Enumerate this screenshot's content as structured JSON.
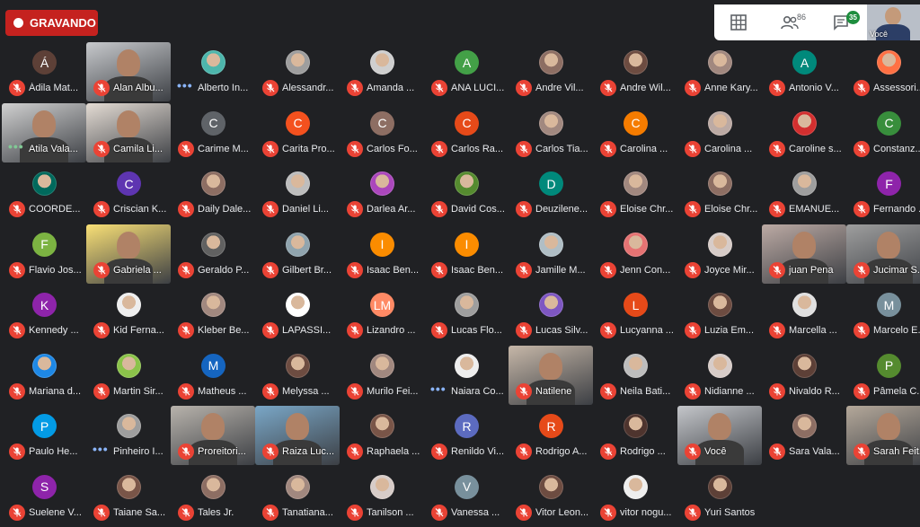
{
  "recording": {
    "label": "GRAVANDO"
  },
  "toolbar": {
    "participants_count": "86",
    "chat_count": "35",
    "self_label": "Você"
  },
  "participants": [
    {
      "name": "Ádila Mat...",
      "avatar": "Á",
      "color": "#5d4037",
      "state": "muted"
    },
    {
      "name": "Alan Albu...",
      "avatar": "",
      "color": "#c7c9cc",
      "state": "muted",
      "video": true
    },
    {
      "name": "Alberto In...",
      "avatar": "",
      "color": "#4db6ac",
      "state": "speaking"
    },
    {
      "name": "Alessandr...",
      "avatar": "",
      "color": "#9e9e9e",
      "state": "muted"
    },
    {
      "name": "Amanda ...",
      "avatar": "",
      "color": "#cfcfcf",
      "state": "muted"
    },
    {
      "name": "ANA LUCI...",
      "avatar": "A",
      "color": "#43a047",
      "state": "muted"
    },
    {
      "name": "Andre Vil...",
      "avatar": "",
      "color": "#8d6e63",
      "state": "muted"
    },
    {
      "name": "Andre Wil...",
      "avatar": "",
      "color": "#6d4c41",
      "state": "muted"
    },
    {
      "name": "Anne Kary...",
      "avatar": "",
      "color": "#a1887f",
      "state": "muted"
    },
    {
      "name": "Antonio V...",
      "avatar": "A",
      "color": "#00897b",
      "state": "muted"
    },
    {
      "name": "Assessori...",
      "avatar": "",
      "color": "#ff7043",
      "state": "muted"
    },
    {
      "name": "Atila Vala...",
      "avatar": "",
      "color": "#d0d0d0",
      "state": "speaking-green",
      "video": true
    },
    {
      "name": "Camila Li...",
      "avatar": "",
      "color": "#e4dcd4",
      "state": "muted",
      "video": true
    },
    {
      "name": "Carime M...",
      "avatar": "C",
      "color": "#5f6368",
      "state": "muted"
    },
    {
      "name": "Carita Pro...",
      "avatar": "C",
      "color": "#f4511e",
      "state": "muted"
    },
    {
      "name": "Carlos Fo...",
      "avatar": "C",
      "color": "#8d6e63",
      "state": "muted"
    },
    {
      "name": "Carlos Ra...",
      "avatar": "C",
      "color": "#e64a19",
      "state": "muted"
    },
    {
      "name": "Carlos Tia...",
      "avatar": "",
      "color": "#a1887f",
      "state": "muted"
    },
    {
      "name": "Carolina ...",
      "avatar": "C",
      "color": "#f57c00",
      "state": "muted"
    },
    {
      "name": "Carolina ...",
      "avatar": "",
      "color": "#bcaaa4",
      "state": "muted"
    },
    {
      "name": "Caroline s...",
      "avatar": "",
      "color": "#d32f2f",
      "state": "muted"
    },
    {
      "name": "Constanz...",
      "avatar": "C",
      "color": "#388e3c",
      "state": "muted"
    },
    {
      "name": "COORDE...",
      "avatar": "",
      "color": "#00695c",
      "state": "muted"
    },
    {
      "name": "Criscian K...",
      "avatar": "C",
      "color": "#5e35b1",
      "state": "muted"
    },
    {
      "name": "Daily Dale...",
      "avatar": "",
      "color": "#8d6e63",
      "state": "muted"
    },
    {
      "name": "Daniel Li...",
      "avatar": "",
      "color": "#bdbdbd",
      "state": "muted"
    },
    {
      "name": "Darlea Ar...",
      "avatar": "",
      "color": "#ab47bc",
      "state": "muted"
    },
    {
      "name": "David Cos...",
      "avatar": "",
      "color": "#558b2f",
      "state": "muted"
    },
    {
      "name": "Deuzilene...",
      "avatar": "D",
      "color": "#00897b",
      "state": "muted"
    },
    {
      "name": "Eloise Chr...",
      "avatar": "",
      "color": "#a1887f",
      "state": "muted"
    },
    {
      "name": "Eloise Chr...",
      "avatar": "",
      "color": "#8d6e63",
      "state": "muted"
    },
    {
      "name": "EMANUE...",
      "avatar": "",
      "color": "#9e9e9e",
      "state": "muted"
    },
    {
      "name": "Fernando ...",
      "avatar": "F",
      "color": "#8e24aa",
      "state": "muted"
    },
    {
      "name": "Flavio Jos...",
      "avatar": "F",
      "color": "#7cb342",
      "state": "muted"
    },
    {
      "name": "Gabriela ...",
      "avatar": "",
      "color": "#f9e076",
      "state": "muted",
      "video": true
    },
    {
      "name": "Geraldo P...",
      "avatar": "",
      "color": "#616161",
      "state": "muted"
    },
    {
      "name": "Gilbert Br...",
      "avatar": "",
      "color": "#90a4ae",
      "state": "muted"
    },
    {
      "name": "Isaac Ben...",
      "avatar": "I",
      "color": "#fb8c00",
      "state": "muted"
    },
    {
      "name": "Isaac Ben...",
      "avatar": "I",
      "color": "#fb8c00",
      "state": "muted"
    },
    {
      "name": "Jamille M...",
      "avatar": "",
      "color": "#b0bec5",
      "state": "muted"
    },
    {
      "name": "Jenn Con...",
      "avatar": "",
      "color": "#e57373",
      "state": "muted"
    },
    {
      "name": "Joyce Mir...",
      "avatar": "",
      "color": "#d7ccc8",
      "state": "muted"
    },
    {
      "name": "juan Pena",
      "avatar": "",
      "color": "#bcaaa4",
      "state": "muted",
      "video": true
    },
    {
      "name": "Jucimar S...",
      "avatar": "",
      "color": "#9e9e9e",
      "state": "muted",
      "video": true
    },
    {
      "name": "Kennedy ...",
      "avatar": "K",
      "color": "#8e24aa",
      "state": "muted"
    },
    {
      "name": "Kid Ferna...",
      "avatar": "",
      "color": "#eeeeee",
      "state": "muted"
    },
    {
      "name": "Kleber Be...",
      "avatar": "",
      "color": "#a1887f",
      "state": "muted"
    },
    {
      "name": "LAPASSI...",
      "avatar": "",
      "color": "#ffffff",
      "state": "muted"
    },
    {
      "name": "Lizandro ...",
      "avatar": "LM",
      "color": "#ff8a65",
      "state": "muted"
    },
    {
      "name": "Lucas Flo...",
      "avatar": "",
      "color": "#9e9e9e",
      "state": "muted"
    },
    {
      "name": "Lucas Silv...",
      "avatar": "",
      "color": "#7e57c2",
      "state": "muted"
    },
    {
      "name": "Lucyanna ...",
      "avatar": "L",
      "color": "#e64a19",
      "state": "muted"
    },
    {
      "name": "Luzia Em...",
      "avatar": "",
      "color": "#6d4c41",
      "state": "muted"
    },
    {
      "name": "Marcella ...",
      "avatar": "",
      "color": "#e0e0e0",
      "state": "muted"
    },
    {
      "name": "Marcelo E...",
      "avatar": "M",
      "color": "#78909c",
      "state": "muted"
    },
    {
      "name": "Mariana d...",
      "avatar": "",
      "color": "#1e88e5",
      "state": "muted"
    },
    {
      "name": "Martin Sir...",
      "avatar": "",
      "color": "#8bc34a",
      "state": "muted"
    },
    {
      "name": "Matheus ...",
      "avatar": "M",
      "color": "#1565c0",
      "state": "muted"
    },
    {
      "name": "Melyssa ...",
      "avatar": "",
      "color": "#6d4c41",
      "state": "muted"
    },
    {
      "name": "Murilo Fei...",
      "avatar": "",
      "color": "#a1887f",
      "state": "muted"
    },
    {
      "name": "Naiara Co...",
      "avatar": "",
      "color": "#eeeeee",
      "state": "speaking"
    },
    {
      "name": "Natilene",
      "avatar": "",
      "color": "#c6b7a8",
      "state": "muted",
      "video": true
    },
    {
      "name": "Neila Bati...",
      "avatar": "",
      "color": "#bdbdbd",
      "state": "muted"
    },
    {
      "name": "Nidianne ...",
      "avatar": "",
      "color": "#d7ccc8",
      "state": "muted"
    },
    {
      "name": "Nivaldo R...",
      "avatar": "",
      "color": "#5d4037",
      "state": "muted"
    },
    {
      "name": "Pâmela C...",
      "avatar": "P",
      "color": "#558b2f",
      "state": "muted"
    },
    {
      "name": "Paulo He...",
      "avatar": "P",
      "color": "#039be5",
      "state": "muted"
    },
    {
      "name": "Pinheiro I...",
      "avatar": "",
      "color": "#9e9e9e",
      "state": "speaking"
    },
    {
      "name": "Proreitori...",
      "avatar": "",
      "color": "#b8b3ac",
      "state": "muted",
      "video": true
    },
    {
      "name": "Raiza Luc...",
      "avatar": "",
      "color": "#7aa7c7",
      "state": "muted",
      "video": true
    },
    {
      "name": "Raphaela ...",
      "avatar": "",
      "color": "#795548",
      "state": "muted"
    },
    {
      "name": "Renildo Vi...",
      "avatar": "R",
      "color": "#5c6bc0",
      "state": "muted"
    },
    {
      "name": "Rodrigo A...",
      "avatar": "R",
      "color": "#e64a19",
      "state": "muted"
    },
    {
      "name": "Rodrigo ...",
      "avatar": "",
      "color": "#4e342e",
      "state": "muted"
    },
    {
      "name": "Você",
      "avatar": "",
      "color": "#c4c6ca",
      "state": "muted",
      "video": true
    },
    {
      "name": "Sara Vala...",
      "avatar": "",
      "color": "#8d6e63",
      "state": "muted"
    },
    {
      "name": "Sarah Feit...",
      "avatar": "",
      "color": "#b4a89a",
      "state": "muted",
      "video": true
    },
    {
      "name": "Suelene V...",
      "avatar": "S",
      "color": "#8e24aa",
      "state": "muted"
    },
    {
      "name": "Taiane Sa...",
      "avatar": "",
      "color": "#795548",
      "state": "muted"
    },
    {
      "name": "Tales Jr.",
      "avatar": "",
      "color": "#8d6e63",
      "state": "muted"
    },
    {
      "name": "Tanatiana...",
      "avatar": "",
      "color": "#a1887f",
      "state": "muted"
    },
    {
      "name": "Tanilson ...",
      "avatar": "",
      "color": "#d7ccc8",
      "state": "muted"
    },
    {
      "name": "Vanessa ...",
      "avatar": "V",
      "color": "#78909c",
      "state": "muted"
    },
    {
      "name": "Vitor Leon...",
      "avatar": "",
      "color": "#6d4c41",
      "state": "muted"
    },
    {
      "name": "vitor nogu...",
      "avatar": "",
      "color": "#eeeeee",
      "state": "muted"
    },
    {
      "name": "Yuri Santos",
      "avatar": "",
      "color": "#5d4037",
      "state": "muted"
    }
  ]
}
